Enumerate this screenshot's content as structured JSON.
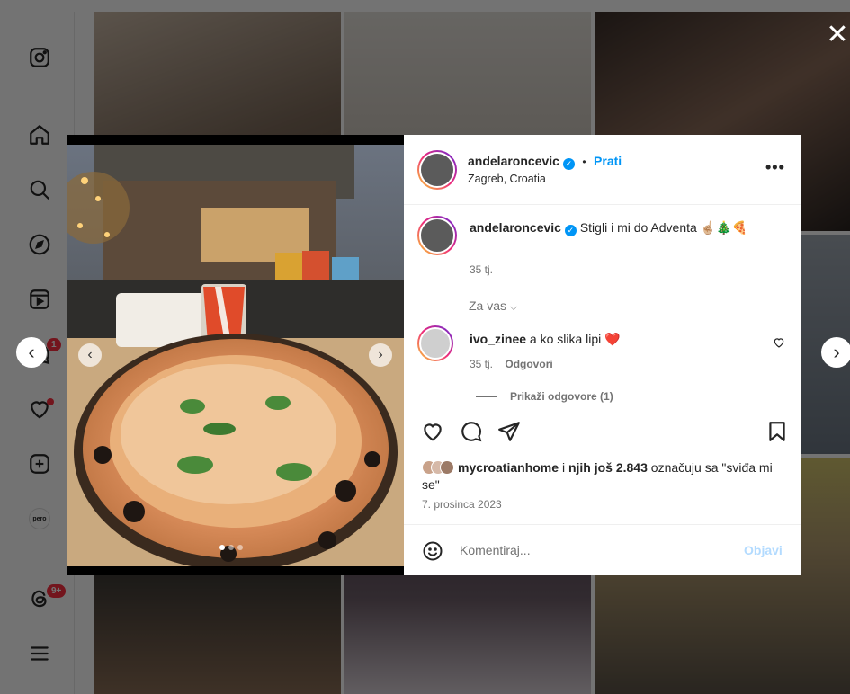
{
  "sidebar": {
    "icons": [
      "instagram-icon",
      "home-icon",
      "search-icon",
      "explore-icon",
      "reels-icon",
      "messages-icon",
      "notifications-icon",
      "create-icon",
      "profile-avatar",
      "threads-icon",
      "menu-icon"
    ],
    "messages_badge": "1",
    "threads_badge": "9+",
    "profile_label": "pero"
  },
  "post": {
    "author": "andelaroncevic",
    "follow_label": "Prati",
    "separator": "•",
    "location": "Zagreb, Croatia",
    "caption": "Stigli i mi do Adventa ☝🏼🎄🍕",
    "caption_time": "35 tj.",
    "section_label": "Za vas",
    "comment": {
      "user": "ivo_zinee",
      "text": "a ko slika lipi ❤️",
      "time": "35 tj.",
      "reply_label": "Odgovori"
    },
    "show_replies": "Prikaži odgovore (1)",
    "likes": {
      "user": "mycroatianhome",
      "and_text": "i",
      "others": "njih još 2.843",
      "suffix": "označuju sa \"sviđa mi se\""
    },
    "date": "7. prosinca 2023",
    "comment_placeholder": "Komentiraj...",
    "post_label": "Objavi",
    "photo_slide_count": 3,
    "photo_active_slide": 1
  },
  "colors": {
    "accent": "#0095f6",
    "notification": "#ff3040",
    "post_disabled": "#b3dbff"
  }
}
